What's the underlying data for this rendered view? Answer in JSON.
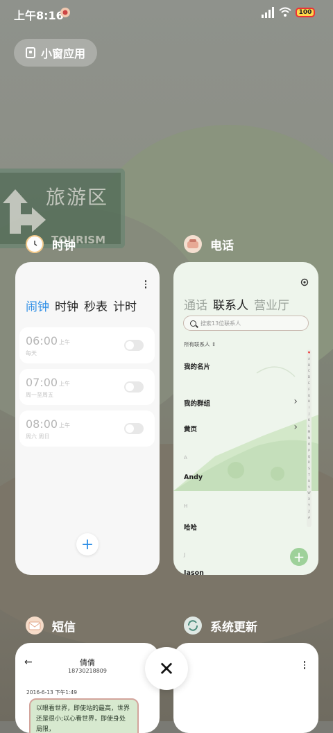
{
  "status_bar": {
    "time": "上午8:16",
    "battery": "100"
  },
  "floating_pill": {
    "label": "小窗应用"
  },
  "wallpaper": {
    "sign_text": "旅游区",
    "sign_sub": "TOURISM"
  },
  "apps": {
    "clock": {
      "name": "时钟",
      "tabs": [
        "闹钟",
        "时钟",
        "秒表",
        "计时"
      ],
      "alarms": [
        {
          "time": "06:00",
          "ampm": "上午",
          "repeat": "每天"
        },
        {
          "time": "07:00",
          "ampm": "上午",
          "repeat": "周一至周五"
        },
        {
          "time": "08:00",
          "ampm": "上午",
          "repeat": "周六 周日"
        }
      ],
      "add": "+"
    },
    "phone": {
      "name": "电话",
      "tabs": [
        "通话",
        "联系人",
        "营业厅"
      ],
      "search_placeholder": "搜索13位联系人",
      "filter": "所有联系人",
      "rows": [
        "我的名片",
        "我的群组",
        "黄页"
      ],
      "letters": [
        "A",
        "H",
        "J"
      ],
      "contacts": [
        "Andy",
        "哈哈",
        "Jason"
      ],
      "alphabet": "♥ABCDEFGHIJKLMNOPQRSTUVWXYZ#",
      "add": "+"
    },
    "sms": {
      "name": "短信",
      "contact_name": "倩倩",
      "contact_number": "18730218809",
      "date": "2016-6-13 下午1:49",
      "message": "以眼看世界，即使站的最高，世界还是很小;以心看世界，即使身处局限，"
    },
    "update": {
      "name": "系统更新"
    }
  },
  "close": "✕",
  "colors": {
    "accent_blue": "#2f8fe6",
    "green": "#9ed19a"
  }
}
